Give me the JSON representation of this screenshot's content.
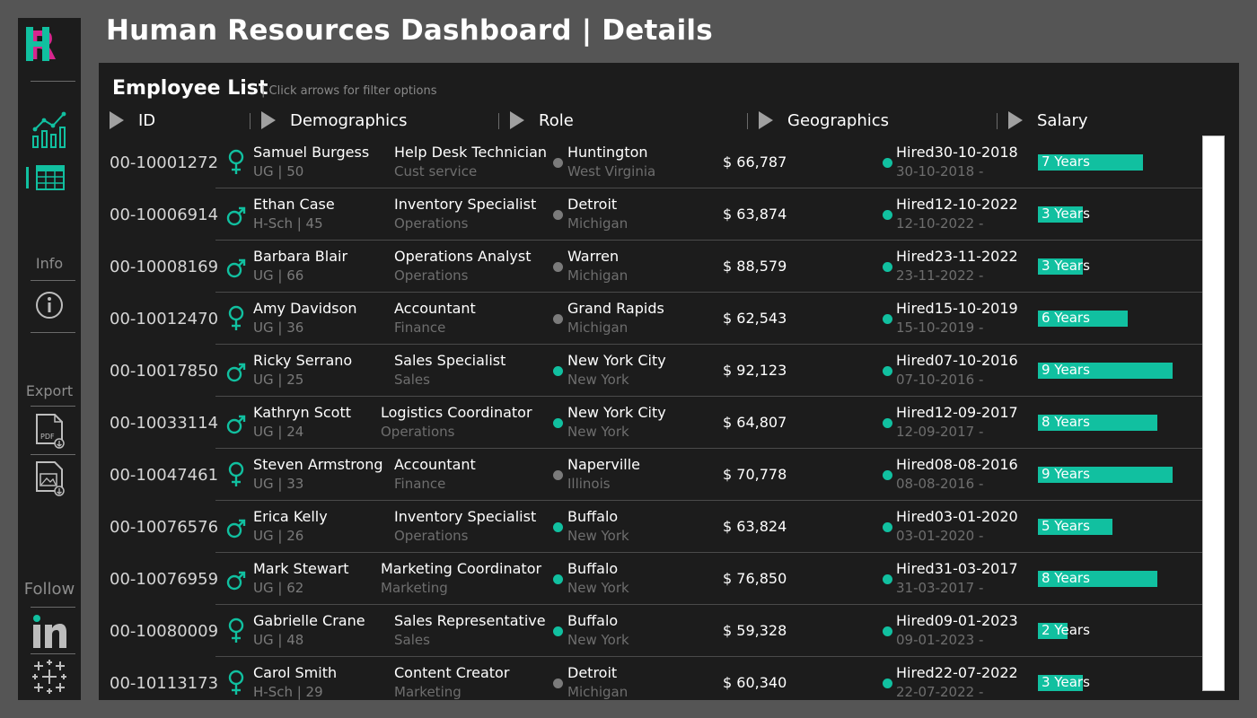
{
  "colors": {
    "accent": "#11c0a0",
    "logo_pink": "#d6278e",
    "bg": "#555555",
    "panel": "#1c1c1c",
    "dot_grey": "#7b7b7b"
  },
  "page": {
    "title": "Human Resources Dashboard | Details"
  },
  "sidebar": {
    "logo": "HR",
    "logo_icon": "hr-logo-icon",
    "nav_icons": [
      "overview-chart-icon",
      "table-details-icon"
    ],
    "info_label": "Info",
    "info_icon": "info-icon",
    "export_label": "Export",
    "export_icons": [
      "pdf-export-icon",
      "image-export-icon"
    ],
    "follow_label": "Follow",
    "follow_icons": [
      "linkedin-icon",
      "tableau-icon"
    ]
  },
  "panel": {
    "title": "Employee List",
    "hint": "| Click arrows for filter options",
    "columns": [
      "ID",
      "Demographics",
      "Role",
      "Geographics",
      "Salary"
    ]
  },
  "employees": [
    {
      "id": "00-10001272",
      "gender": "female",
      "name": "Samuel Burgess",
      "demo": "UG | 50",
      "role": "Help Desk Technician",
      "dept": "Cust service",
      "city": "Huntington",
      "state": "West Virginia",
      "hq": false,
      "salary": "$ 66,787",
      "hired": "Hired30-10-2018",
      "hire_date": "30-10-2018 -",
      "tenure": "7 Years",
      "years": 7
    },
    {
      "id": "00-10006914",
      "gender": "male",
      "name": "Ethan Case",
      "demo": "H-Sch | 45",
      "role": "Inventory Specialist",
      "dept": "Operations",
      "city": "Detroit",
      "state": "Michigan",
      "hq": false,
      "salary": "$ 63,874",
      "hired": "Hired12-10-2022",
      "hire_date": "12-10-2022 -",
      "tenure": "3 Years",
      "years": 3
    },
    {
      "id": "00-10008169",
      "gender": "male",
      "name": "Barbara Blair",
      "demo": "UG | 66",
      "role": "Operations Analyst",
      "dept": "Operations",
      "city": "Warren",
      "state": "Michigan",
      "hq": false,
      "salary": "$ 88,579",
      "hired": "Hired23-11-2022",
      "hire_date": "23-11-2022 -",
      "tenure": "3 Years",
      "years": 3
    },
    {
      "id": "00-10012470",
      "gender": "female",
      "name": "Amy Davidson",
      "demo": "UG | 36",
      "role": "Accountant",
      "dept": "Finance",
      "city": "Grand Rapids",
      "state": "Michigan",
      "hq": false,
      "salary": "$ 62,543",
      "hired": "Hired15-10-2019",
      "hire_date": "15-10-2019 -",
      "tenure": "6 Years",
      "years": 6
    },
    {
      "id": "00-10017850",
      "gender": "male",
      "name": "Ricky Serrano",
      "demo": "UG | 25",
      "role": "Sales Specialist",
      "dept": "Sales",
      "city": "New York City",
      "state": "New York",
      "hq": true,
      "salary": "$ 92,123",
      "hired": "Hired07-10-2016",
      "hire_date": "07-10-2016 -",
      "tenure": "9 Years",
      "years": 9
    },
    {
      "id": "00-10033114",
      "gender": "male",
      "name": "Kathryn Scott",
      "demo": "UG | 24",
      "role": "Logistics Coordinator",
      "dept": "Operations",
      "city": "New York City",
      "state": "New York",
      "hq": true,
      "salary": "$ 64,807",
      "hired": "Hired12-09-2017",
      "hire_date": "12-09-2017 -",
      "tenure": "8 Years",
      "years": 8
    },
    {
      "id": "00-10047461",
      "gender": "female",
      "name": "Steven Armstrong",
      "demo": "UG | 33",
      "role": "Accountant",
      "dept": "Finance",
      "city": "Naperville",
      "state": "Illinois",
      "hq": false,
      "salary": "$ 70,778",
      "hired": "Hired08-08-2016",
      "hire_date": "08-08-2016 -",
      "tenure": "9 Years",
      "years": 9
    },
    {
      "id": "00-10076576",
      "gender": "male",
      "name": "Erica Kelly",
      "demo": "UG | 26",
      "role": "Inventory Specialist",
      "dept": "Operations",
      "city": "Buffalo",
      "state": "New York",
      "hq": true,
      "salary": "$ 63,824",
      "hired": "Hired03-01-2020",
      "hire_date": "03-01-2020 -",
      "tenure": "5 Years",
      "years": 5
    },
    {
      "id": "00-10076959",
      "gender": "male",
      "name": "Mark Stewart",
      "demo": "UG | 62",
      "role": "Marketing Coordinator",
      "dept": "Marketing",
      "city": "Buffalo",
      "state": "New York",
      "hq": true,
      "salary": "$ 76,850",
      "hired": "Hired31-03-2017",
      "hire_date": "31-03-2017 -",
      "tenure": "8 Years",
      "years": 8
    },
    {
      "id": "00-10080009",
      "gender": "female",
      "name": "Gabrielle Crane",
      "demo": "UG | 48",
      "role": "Sales Representative",
      "dept": "Sales",
      "city": "Buffalo",
      "state": "New York",
      "hq": true,
      "salary": "$ 59,328",
      "hired": "Hired09-01-2023",
      "hire_date": "09-01-2023 -",
      "tenure": "2 Years",
      "years": 2
    },
    {
      "id": "00-10113173",
      "gender": "female",
      "name": "Carol Smith",
      "demo": "H-Sch | 29",
      "role": "Content Creator",
      "dept": "Marketing",
      "city": "Detroit",
      "state": "Michigan",
      "hq": false,
      "salary": "$ 60,340",
      "hired": "Hired22-07-2022",
      "hire_date": "22-07-2022 -",
      "tenure": "3 Years",
      "years": 3
    }
  ]
}
